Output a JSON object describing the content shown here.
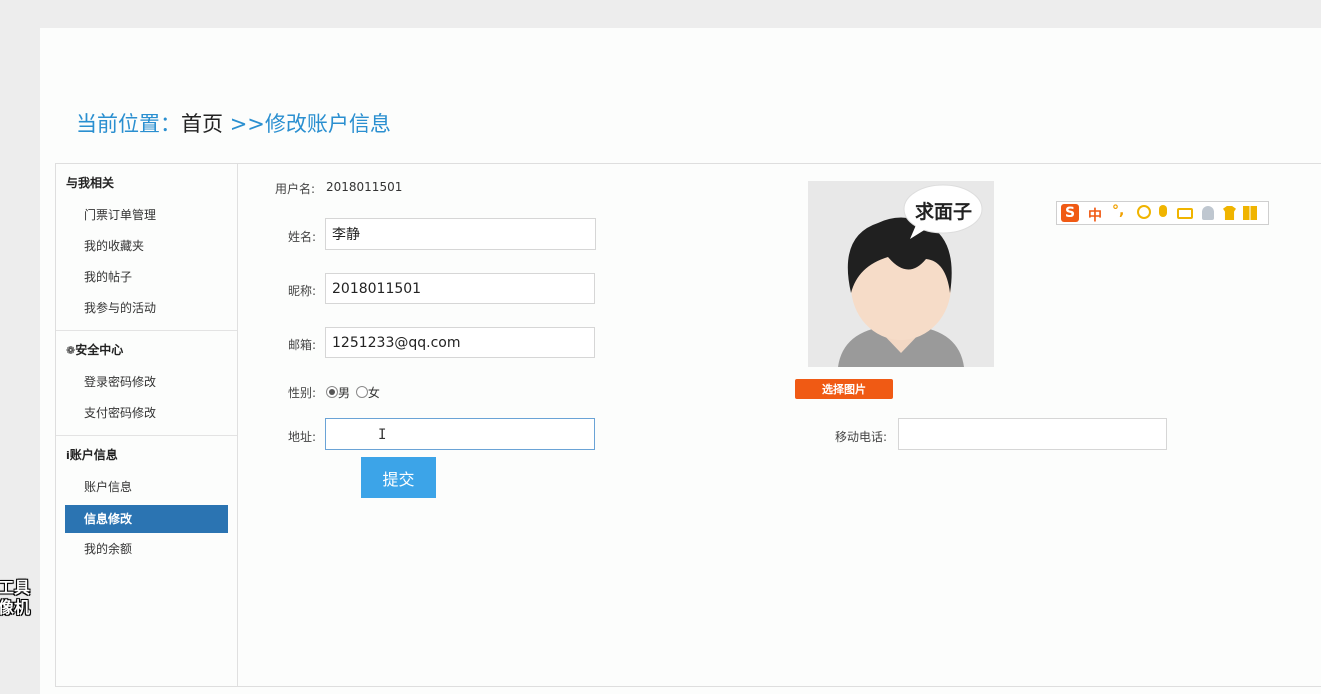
{
  "breadcrumb": {
    "prefix": "当前位置：",
    "home": "首页",
    "separator": ">>",
    "current": "修改账户信息"
  },
  "sidebar": {
    "sections": [
      {
        "title": "与我相关",
        "items": [
          "门票订单管理",
          "我的收藏夹",
          "我的帖子",
          "我参与的活动"
        ]
      },
      {
        "title": "安全中心",
        "icon": "gear-icon",
        "items": [
          "登录密码修改",
          "支付密码修改"
        ]
      },
      {
        "title": "账户信息",
        "icon": "info-icon",
        "items": [
          "账户信息",
          "信息修改",
          "我的余额"
        ],
        "active_index": 1
      }
    ]
  },
  "form": {
    "username_label": "用户名:",
    "username_value": "2018011501",
    "name_label": "姓名:",
    "name_value": "李静",
    "nickname_label": "昵称:",
    "nickname_value": "2018011501",
    "email_label": "邮箱:",
    "email_value": "1251233@qq.com",
    "gender_label": "性别:",
    "gender_male": "男",
    "gender_female": "女",
    "gender_selected": "男",
    "address_label": "地址:",
    "address_value": "",
    "mobile_label": "移动电话:",
    "mobile_value": "",
    "submit_label": "提交"
  },
  "avatar": {
    "caption": "求面子",
    "choose_label": "选择图片"
  },
  "ime_toolbar": {
    "logo": "S",
    "mode": "中",
    "punct": "°,",
    "icons": [
      "smiley-icon",
      "microphone-icon",
      "keyboard-icon",
      "user-icon",
      "shirt-icon",
      "grid-icon"
    ],
    "colors": {
      "brand": "#f05a14",
      "icons": "#f0b400"
    }
  },
  "watermark": {
    "line1": "工具",
    "line2": "像机"
  }
}
